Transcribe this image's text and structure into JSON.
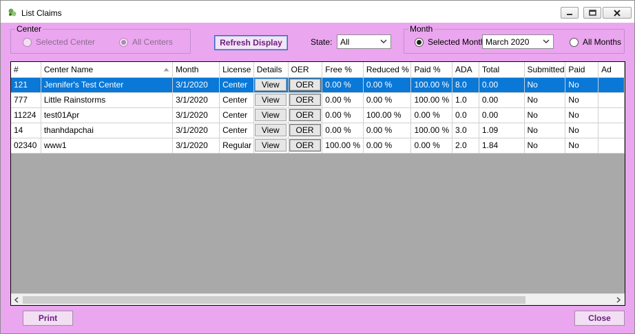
{
  "window": {
    "title": "List Claims"
  },
  "center_group": {
    "legend": "Center",
    "selected_label": "Selected Center",
    "all_label": "All Centers"
  },
  "refresh_label": "Refresh Display",
  "state": {
    "label": "State:",
    "value": "All"
  },
  "month_group": {
    "legend": "Month",
    "selected_label": "Selected Month",
    "month_value": "March 2020",
    "all_label": "All Months"
  },
  "grid": {
    "columns": [
      "#",
      "Center Name",
      "Month",
      "License",
      "Details",
      "OER",
      "Free %",
      "Reduced %",
      "Paid %",
      "ADA",
      "Total",
      "Submitted",
      "Paid",
      "Ad"
    ],
    "rows": [
      [
        "121",
        "Jennifer's Test Center",
        "3/1/2020",
        "Center",
        "View",
        "OER",
        "0.00 %",
        "0.00 %",
        "100.00 %",
        "8.0",
        "0.00",
        "No",
        "No",
        ""
      ],
      [
        "777",
        "Little Rainstorms",
        "3/1/2020",
        "Center",
        "View",
        "OER",
        "0.00 %",
        "0.00 %",
        "100.00 %",
        "1.0",
        "0.00",
        "No",
        "No",
        ""
      ],
      [
        "11224",
        "test01Apr",
        "3/1/2020",
        "Center",
        "View",
        "OER",
        "0.00 %",
        "100.00 %",
        "0.00 %",
        "0.0",
        "0.00",
        "No",
        "No",
        ""
      ],
      [
        "14",
        "thanhdapchai",
        "3/1/2020",
        "Center",
        "View",
        "OER",
        "0.00 %",
        "0.00 %",
        "100.00 %",
        "3.0",
        "1.09",
        "No",
        "No",
        ""
      ],
      [
        "02340",
        "www1",
        "3/1/2020",
        "Regular",
        "View",
        "OER",
        "100.00 %",
        "0.00 %",
        "0.00 %",
        "2.0",
        "1.84",
        "No",
        "No",
        ""
      ]
    ],
    "selected_row": 0
  },
  "footer": {
    "print_label": "Print",
    "close_label": "Close"
  },
  "colors": {
    "background": "#eaa6ee",
    "selection": "#0a78d7",
    "button_text": "#6a1f82"
  },
  "icons": {
    "app": "app-icon",
    "minimize": "minimize-icon",
    "maximize": "restore-icon",
    "close": "close-icon"
  }
}
